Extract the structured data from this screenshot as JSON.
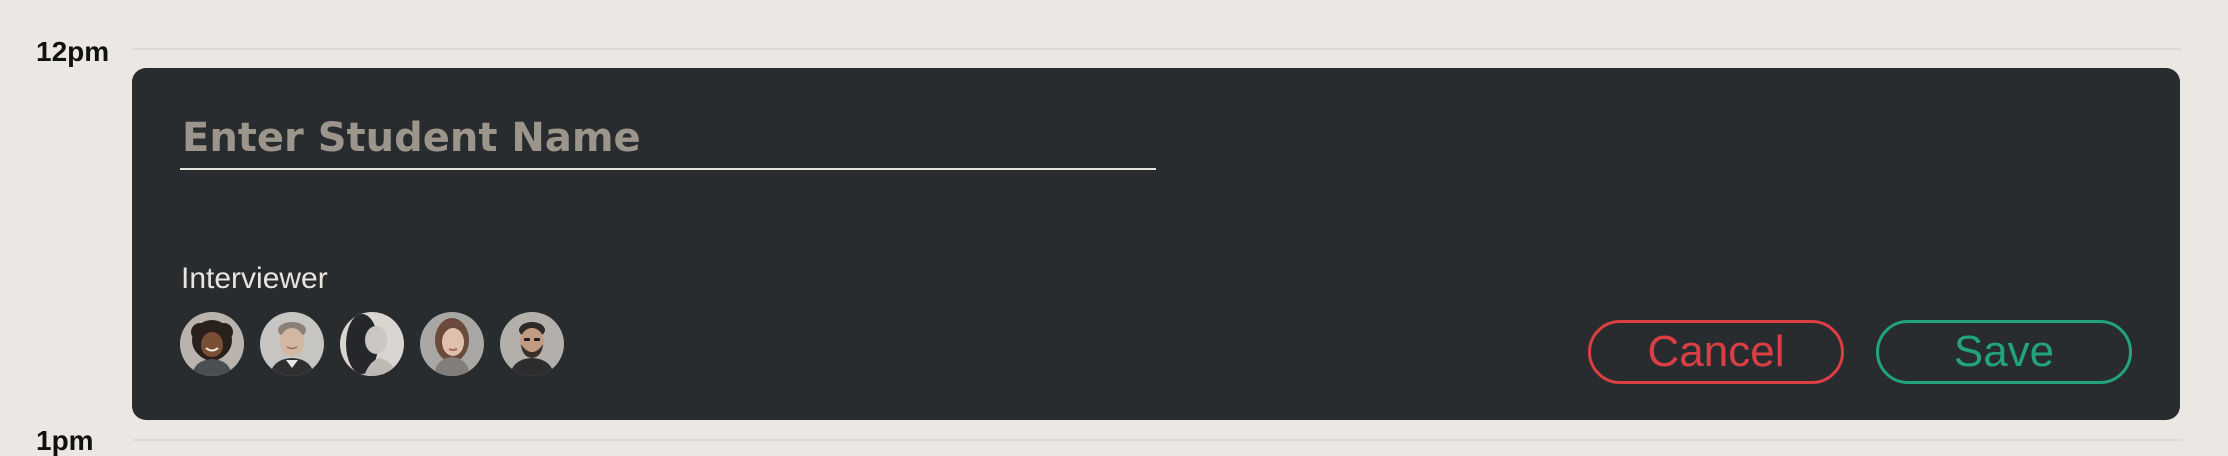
{
  "schedule": {
    "time_start": "12pm",
    "time_end": "1pm"
  },
  "form": {
    "student_name_value": "",
    "student_name_placeholder": "Enter Student Name",
    "interviewer_label": "Interviewer",
    "interviewers": [
      {
        "avatar": "woman-curly-hair-photo"
      },
      {
        "avatar": "man-light-hair-photo"
      },
      {
        "avatar": "woman-dark-hair-photo"
      },
      {
        "avatar": "woman-brown-hair-photo"
      },
      {
        "avatar": "man-beard-photo"
      }
    ]
  },
  "actions": {
    "cancel_label": "Cancel",
    "save_label": "Save"
  },
  "colors": {
    "card_background": "#292c2f",
    "page_background": "#ebe7e2",
    "cancel_accent": "#dc3f43",
    "save_accent": "#22a37a"
  }
}
